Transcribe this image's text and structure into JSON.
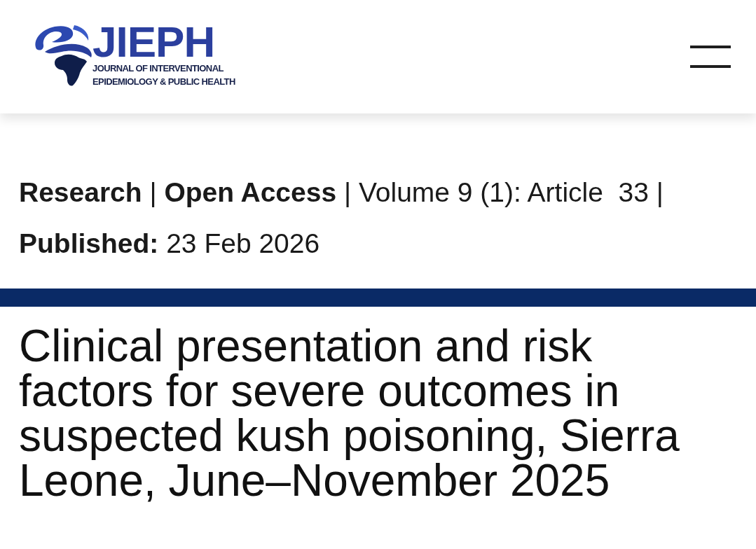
{
  "header": {
    "logo": {
      "acronym": "JIEPH",
      "subtitle_lines": [
        "JOURNAL OF INTERVENTIONAL",
        "EPIDEMIOLOGY & PUBLIC HEALTH"
      ]
    }
  },
  "meta": {
    "lines": [
      "**Research** | **Open Access** | Volume 9 (1): Article  33 |",
      "**Published:** 23 Feb 2026"
    ]
  },
  "article": {
    "title": "Clinical presentation and risk factors for severe outcomes in suspected kush poisoning, Sierra Leone, June–November 2025"
  }
}
